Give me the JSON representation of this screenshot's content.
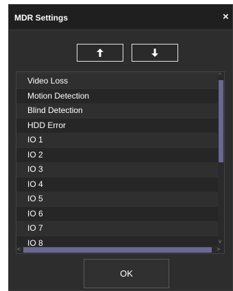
{
  "dialog": {
    "title": "MDR Settings",
    "close_label": "×",
    "ok_label": "OK"
  },
  "toolbar": {
    "move_up_icon": "arrow-up-icon",
    "move_down_icon": "arrow-down-icon"
  },
  "list": {
    "items": [
      {
        "label": "Video Loss"
      },
      {
        "label": "Motion Detection"
      },
      {
        "label": "Blind Detection"
      },
      {
        "label": "HDD Error"
      },
      {
        "label": "IO 1"
      },
      {
        "label": "IO 2"
      },
      {
        "label": "IO 3"
      },
      {
        "label": "IO 4"
      },
      {
        "label": "IO 5"
      },
      {
        "label": "IO 6"
      },
      {
        "label": "IO 7"
      },
      {
        "label": "IO 8"
      }
    ]
  },
  "scrollbars": {
    "up_glyph": "^",
    "down_glyph": "v",
    "left_glyph": "<",
    "right_glyph": ">"
  },
  "colors": {
    "dialog_bg": "#2d2d2d",
    "titlebar_bg": "#1f1f1f",
    "scroll_thumb": "#6a6790",
    "text": "#ffffff"
  }
}
